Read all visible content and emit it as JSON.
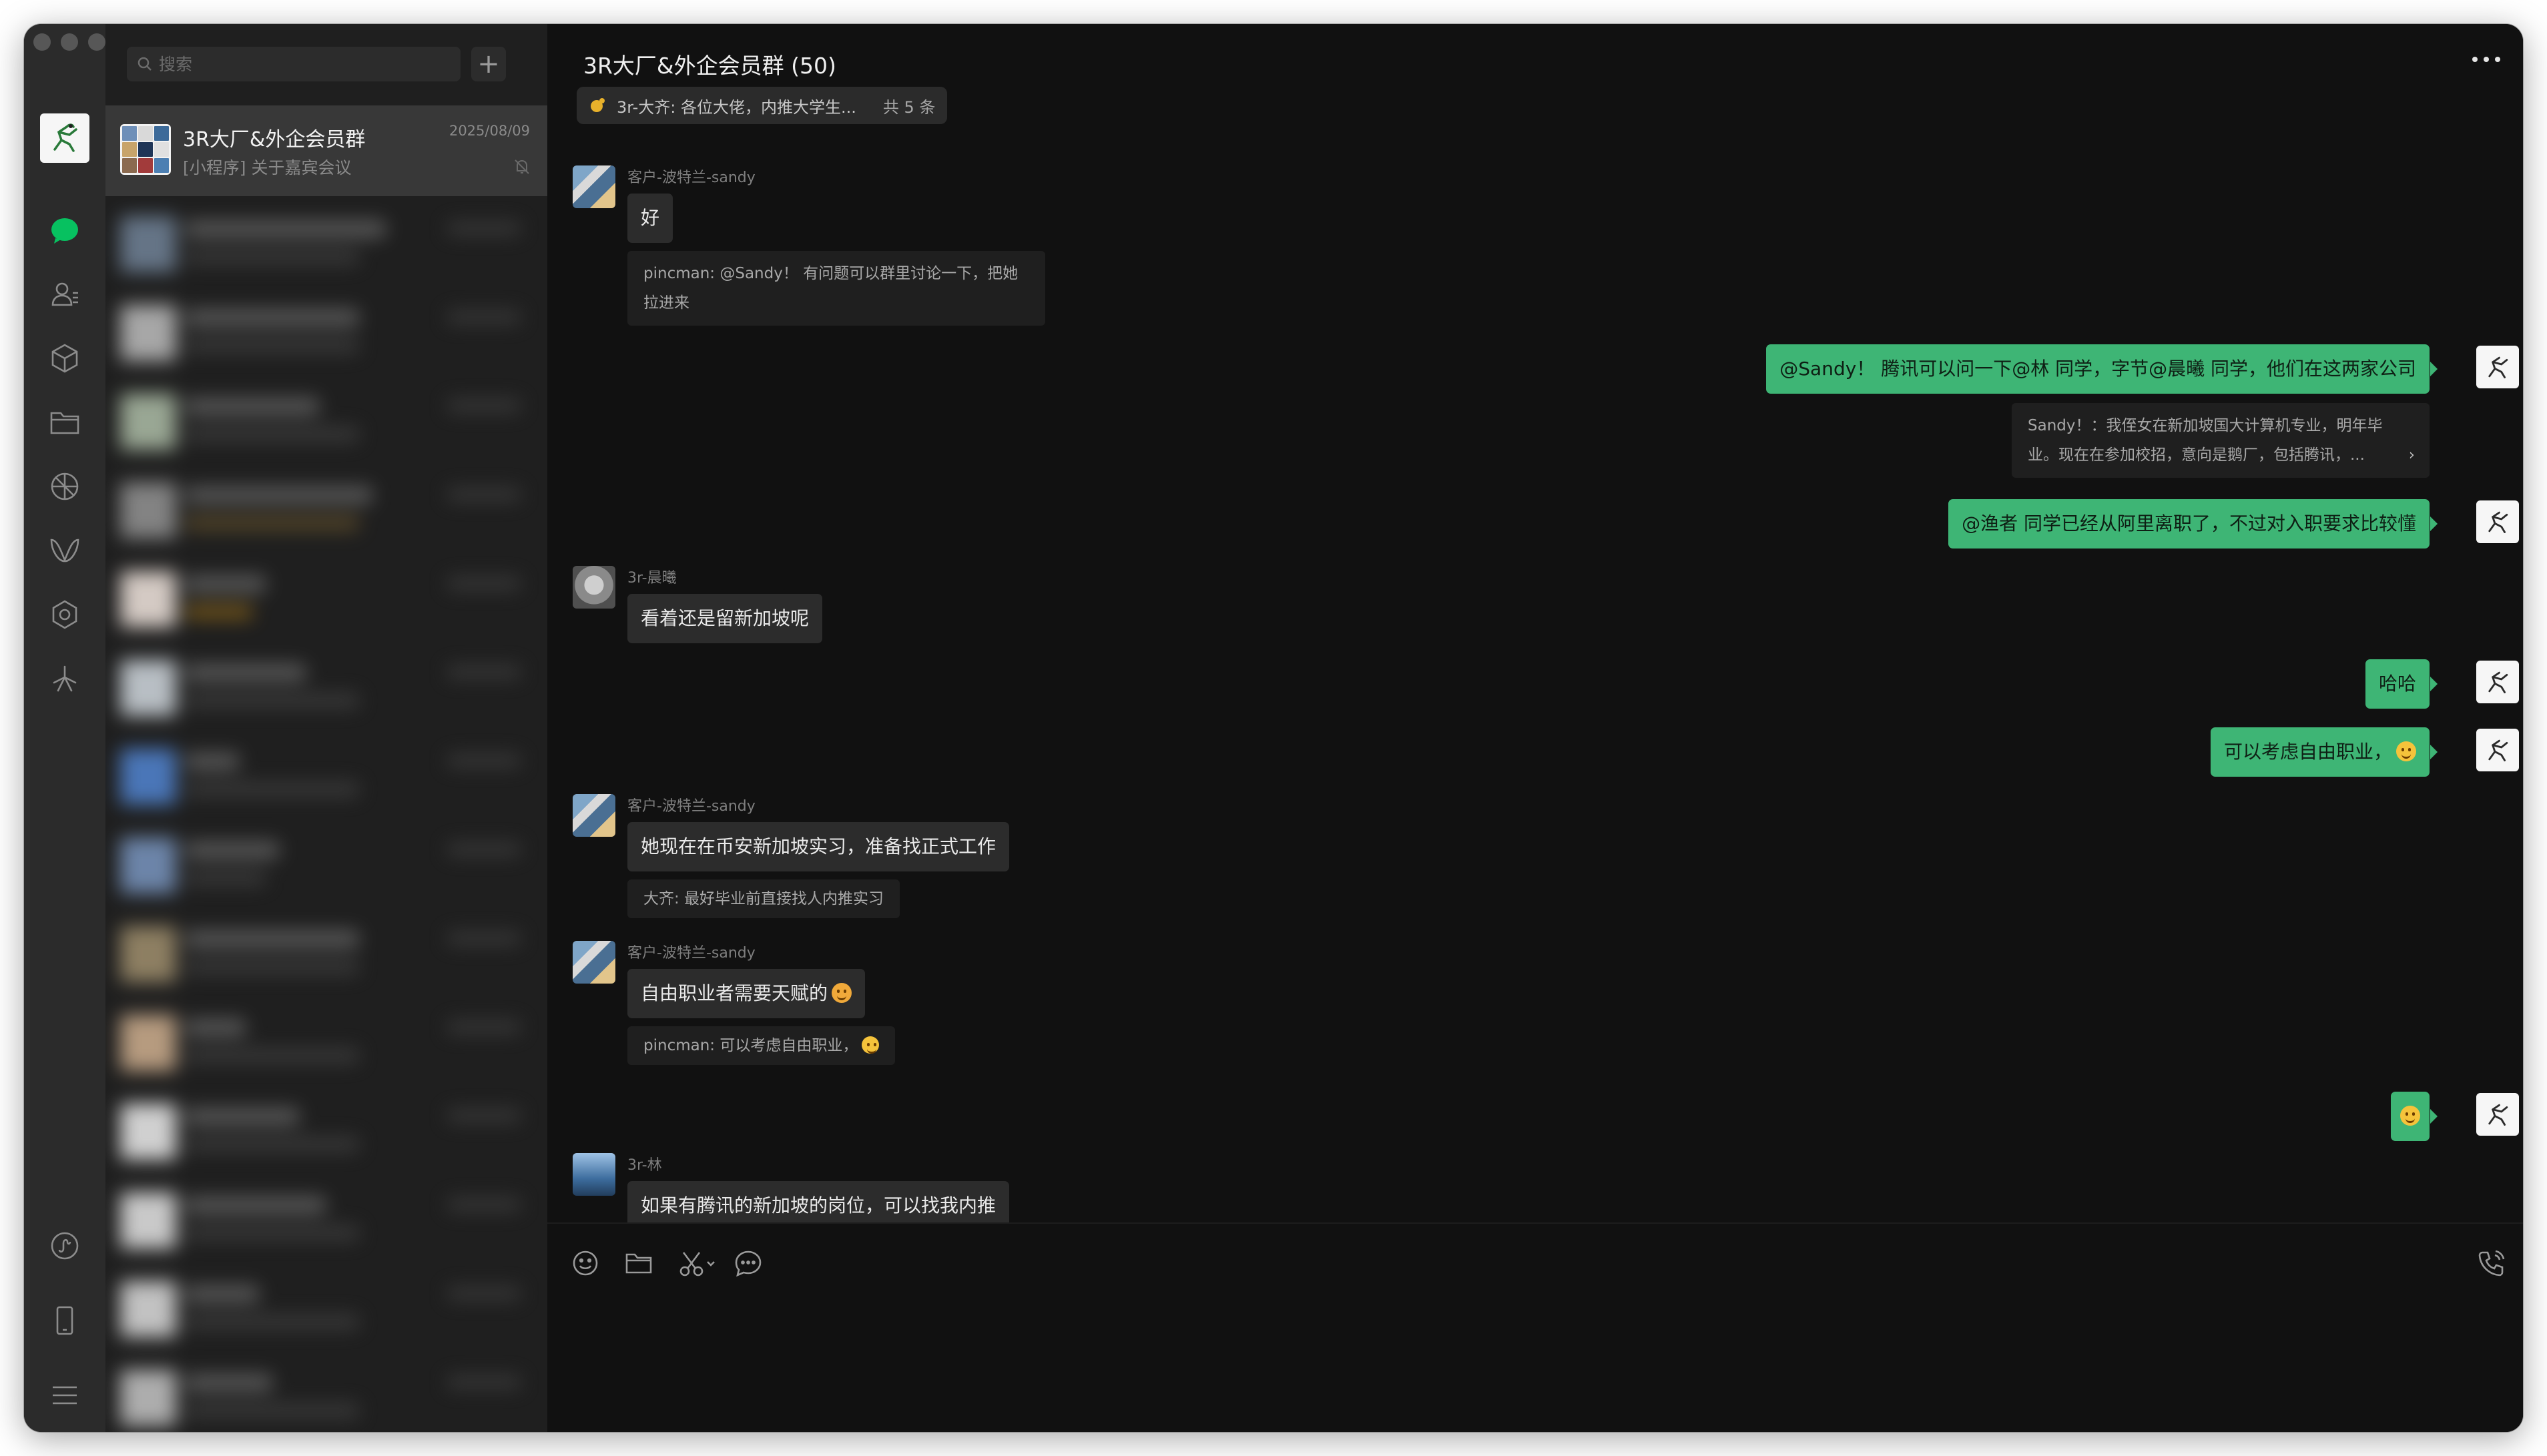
{
  "window": {
    "controls": [
      "close",
      "minimize",
      "zoom"
    ]
  },
  "rail": {
    "top_icons": [
      "chats-icon",
      "contacts-icon",
      "favorites-icon",
      "files-icon",
      "moments-icon",
      "channels-icon",
      "mini-programs-icon",
      "search-discover-icon"
    ],
    "bottom_icons": [
      "mini-program-panel-icon",
      "phone-icon",
      "menu-icon"
    ],
    "accent": "#07c160"
  },
  "sessions": {
    "search_placeholder": "搜索",
    "add_label": "+",
    "active": {
      "name": "3R大厂&外企会员群",
      "preview": "[小程序] 关于嘉宾会议",
      "time": "2025/08/09"
    }
  },
  "chat": {
    "title": "3R大厂&外企会员群 (50)",
    "pinned": {
      "text": "3r-大齐: 各位大佬，内推大学生...",
      "count": "共 5 条"
    },
    "messages": [
      {
        "sender": "客户-波特兰-sandy",
        "text": "好",
        "quote": "pincman: @Sandy！ 有问题可以群里讨论一下，把她拉进来"
      },
      {
        "mine": true,
        "text": "@Sandy！ 腾讯可以问一下@林 同学，字节@晨曦 同学，他们在这两家公司",
        "quote": "Sandy！：我侄女在新加坡国大计算机专业，明年毕业。现在在参加校招，意向是鹅厂，包括腾讯，..."
      },
      {
        "mine": true,
        "text": "@渔者 同学已经从阿里离职了，不过对入职要求比较懂"
      },
      {
        "sender": "3r-晨曦",
        "text": "看着还是留新加坡呢"
      },
      {
        "mine": true,
        "text": "哈哈"
      },
      {
        "mine": true,
        "text": "可以考虑自由职业，"
      },
      {
        "sender": "客户-波特兰-sandy",
        "text": "她现在在币安新加坡实习，准备找正式工作",
        "quote": "大齐: 最好毕业前直接找人内推实习"
      },
      {
        "sender": "客户-波特兰-sandy",
        "text": "自由职业者需要天赋的",
        "quote": "pincman: 可以考虑自由职业，"
      },
      {
        "mine": true,
        "text": ""
      },
      {
        "sender": "3r-林",
        "text": "如果有腾讯的新加坡的岗位，可以找我内推"
      }
    ],
    "composer_tools": [
      "emoji-icon",
      "folder-icon",
      "scissors-icon",
      "chat-history-icon",
      "voice-call-icon"
    ]
  }
}
